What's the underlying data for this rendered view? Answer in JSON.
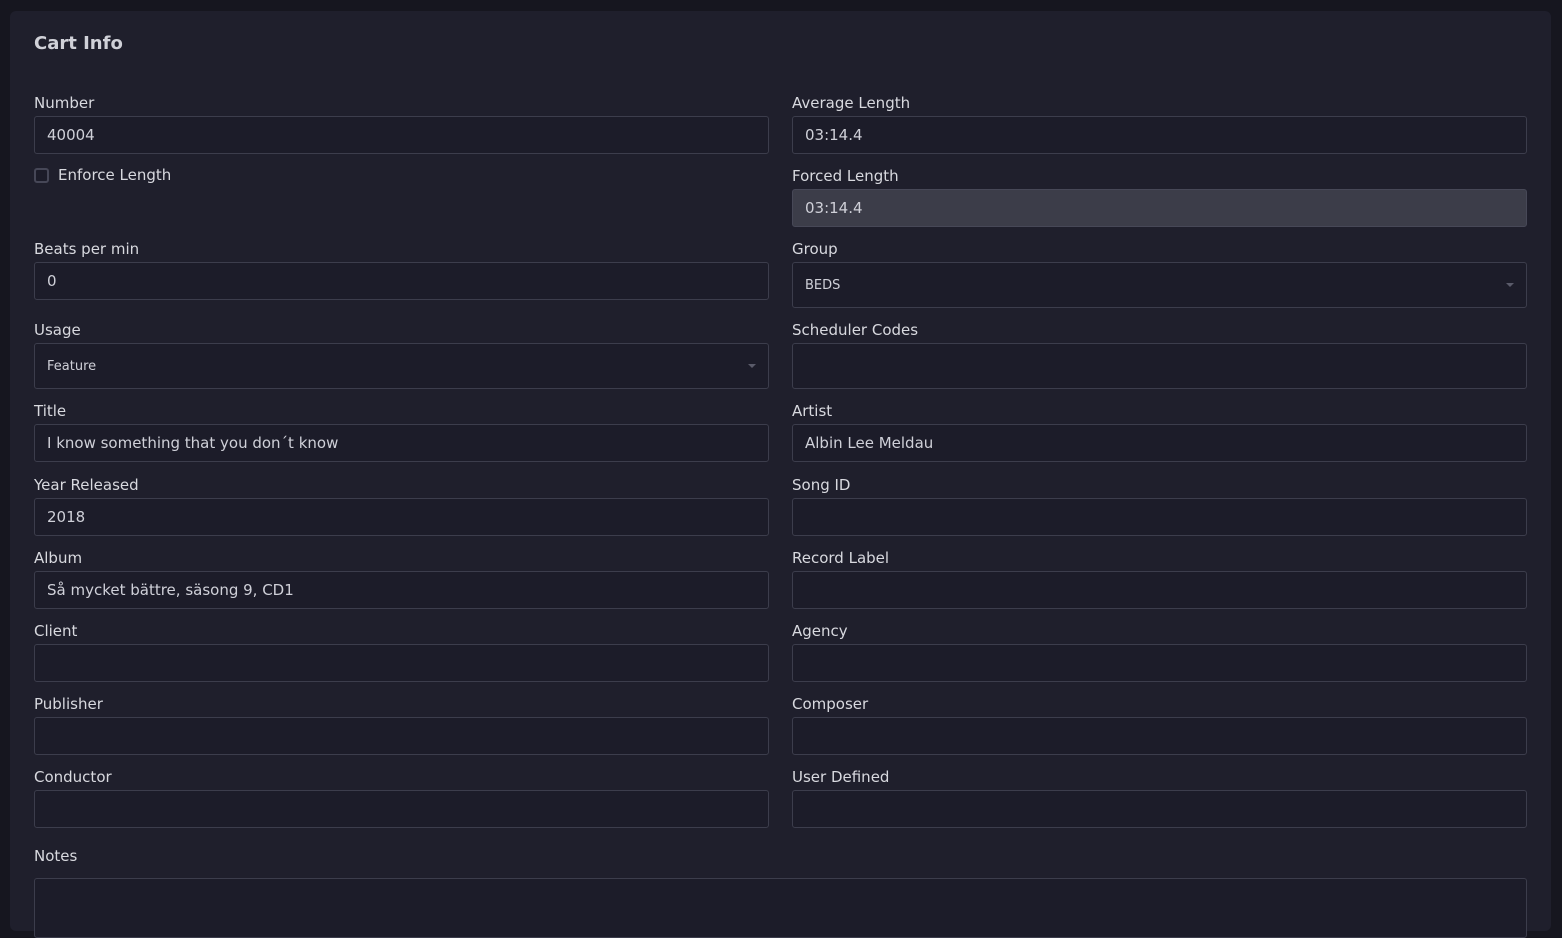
{
  "card": {
    "title": "Cart Info"
  },
  "fields": {
    "number": {
      "label": "Number",
      "value": "40004"
    },
    "average_length": {
      "label": "Average Length",
      "value": "03:14.4"
    },
    "enforce_length": {
      "label": "Enforce Length",
      "checked": false
    },
    "forced_length": {
      "label": "Forced Length",
      "value": "03:14.4"
    },
    "bpm": {
      "label": "Beats per min",
      "value": "0"
    },
    "group": {
      "label": "Group",
      "value": "BEDS"
    },
    "usage": {
      "label": "Usage",
      "value": "Feature"
    },
    "scheduler_codes": {
      "label": "Scheduler Codes",
      "value": ""
    },
    "title": {
      "label": "Title",
      "value": "I know something that you don´t know"
    },
    "artist": {
      "label": "Artist",
      "value": "Albin Lee Meldau"
    },
    "year_released": {
      "label": "Year Released",
      "value": "2018"
    },
    "song_id": {
      "label": "Song ID",
      "value": ""
    },
    "album": {
      "label": "Album",
      "value": "Så mycket bättre, säsong 9, CD1"
    },
    "record_label": {
      "label": "Record Label",
      "value": ""
    },
    "client": {
      "label": "Client",
      "value": ""
    },
    "agency": {
      "label": "Agency",
      "value": ""
    },
    "publisher": {
      "label": "Publisher",
      "value": ""
    },
    "composer": {
      "label": "Composer",
      "value": ""
    },
    "conductor": {
      "label": "Conductor",
      "value": ""
    },
    "user_defined": {
      "label": "User Defined",
      "value": ""
    },
    "notes": {
      "label": "Notes",
      "value": ""
    }
  }
}
